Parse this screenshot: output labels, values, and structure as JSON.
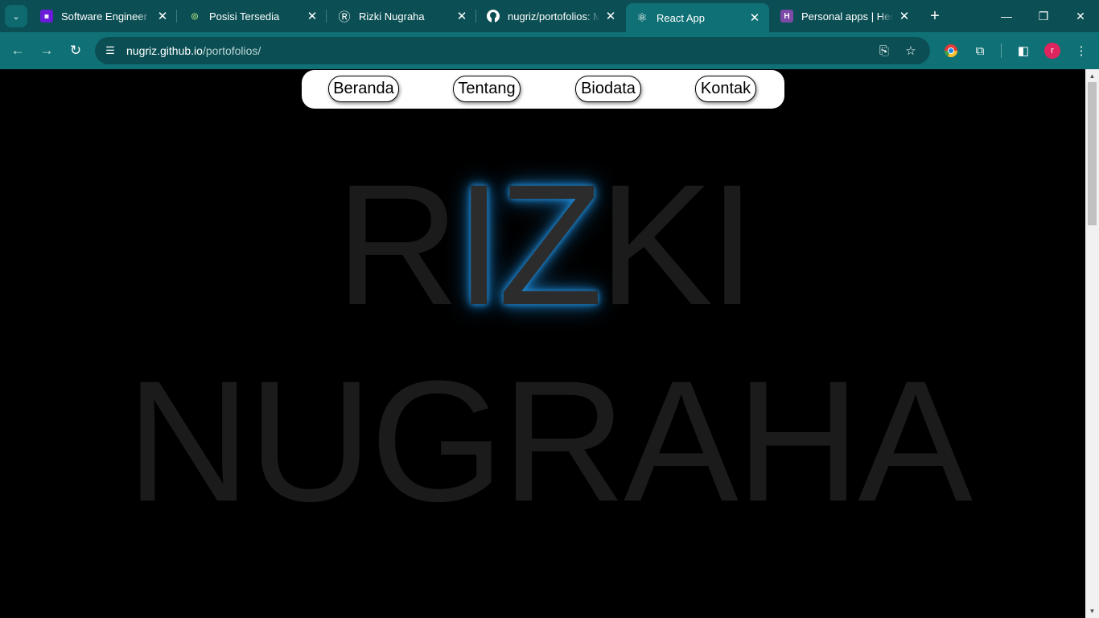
{
  "browser": {
    "tabs": [
      {
        "title": "Software Engineer (Ba",
        "favicon": "",
        "favicon_color": "#6a1bd9"
      },
      {
        "title": "Posisi Tersedia",
        "favicon": "◎",
        "favicon_color": "#2e7d32"
      },
      {
        "title": "Rizki Nugraha",
        "favicon": "Ⓡ",
        "favicon_color": "#0b4f54"
      },
      {
        "title": "nugriz/portofolios: M",
        "favicon": "●",
        "favicon_color": "#0b4f54"
      },
      {
        "title": "React App",
        "favicon": "⚛",
        "favicon_color": "#0f7176",
        "active": true
      },
      {
        "title": "Personal apps | Herok",
        "favicon": "H",
        "favicon_color": "#7d4aa8"
      }
    ],
    "new_tab": "+",
    "address": {
      "host": "nugriz.github.io",
      "path": "/portofolios/"
    },
    "profile_initial": "r"
  },
  "nav": {
    "items": [
      "Beranda",
      "Tentang",
      "Biodata",
      "Kontak"
    ]
  },
  "hero": {
    "line1": {
      "before": "R",
      "glow": "IZ",
      "after": "KI"
    },
    "line2": "NUGRAHA",
    "glow_color": "#1e88d4"
  }
}
